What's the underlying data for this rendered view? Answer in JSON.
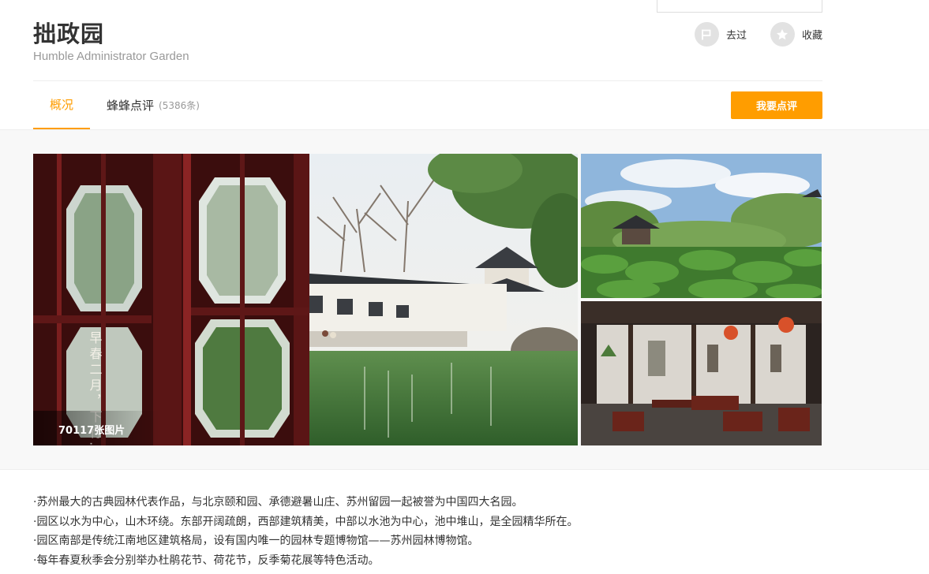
{
  "poi": {
    "name_cn": "拙政园",
    "name_en": "Humble Administrator Garden"
  },
  "actions": {
    "visited_label": "去过",
    "favorite_label": "收藏"
  },
  "tabs": {
    "overview_label": "概况",
    "reviews_label": "蜂蜂点评",
    "reviews_count": "(5386条)"
  },
  "review_button_label": "我要点评",
  "gallery": {
    "photo_count_label": "70117张图片",
    "main_photo_overlay_text": "早春二月，下行…南"
  },
  "description": [
    "·苏州最大的古典园林代表作品，与北京颐和园、承德避暑山庄、苏州留园一起被誉为中国四大名园。",
    "·园区以水为中心，山木环绕。东部开阔疏朗，西部建筑精美，中部以水池为中心，池中堆山，是全园精华所在。",
    "·园区南部是传统江南地区建筑格局，设有国内唯一的园林专题博物馆——苏州园林博物馆。",
    "·每年春夏秋季会分别举办杜鹃花节、荷花节，反季菊花展等特色活动。"
  ],
  "icons": {
    "visited": "flag-icon",
    "favorite": "star-icon"
  },
  "colors": {
    "accent": "#ff9d00",
    "text": "#333333",
    "muted": "#999999",
    "icon_bg": "#e2e2e2",
    "divider": "#eeeeee",
    "band_bg": "#f8f8f8"
  }
}
